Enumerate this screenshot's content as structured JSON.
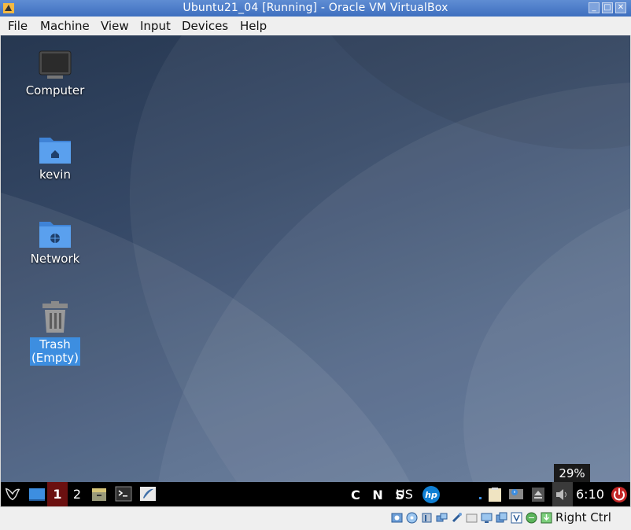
{
  "window": {
    "title": "Ubuntu21_04 [Running] - Oracle VM VirtualBox"
  },
  "menu": [
    "File",
    "Machine",
    "View",
    "Input",
    "Devices",
    "Help"
  ],
  "desktop_icons": [
    {
      "label": "Computer",
      "icon": "monitor-icon"
    },
    {
      "label": "kevin",
      "icon": "home-folder-icon"
    },
    {
      "label": "Network",
      "icon": "network-folder-icon"
    },
    {
      "label": "Trash\n(Empty)",
      "icon": "trash-icon",
      "selected": true
    }
  ],
  "panel": {
    "workspaces": [
      "1",
      "2"
    ],
    "active_workspace": "1",
    "keyboard_indicators": "C N S",
    "keyboard_layout": "US",
    "clock": "6:10",
    "volume_tooltip": "29%"
  },
  "statusbar": {
    "host_key": "Right Ctrl"
  },
  "colors": {
    "titlebar": "#4a7bc8",
    "panel": "#000000",
    "selection": "#3d8ee0",
    "workspace_active": "#6b1010"
  }
}
